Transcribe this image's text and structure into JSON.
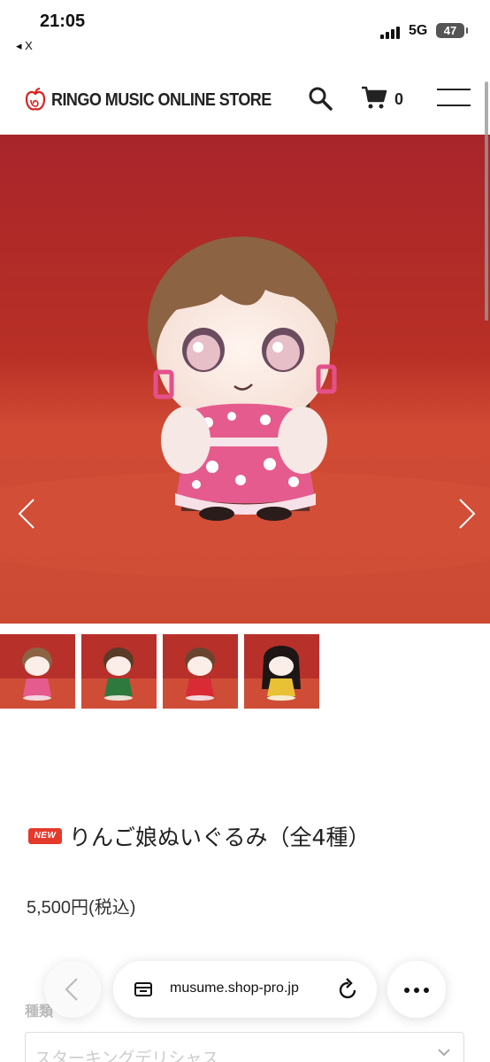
{
  "status_bar": {
    "time": "21:05",
    "back_app": "◂ X",
    "network": "5G",
    "battery": "47"
  },
  "header": {
    "store_name": "RINGO MUSIC ONLINE STORE",
    "cart_count": "0",
    "icons": {
      "logo": "apple-logo-icon",
      "search": "search-icon",
      "cart": "cart-icon",
      "menu": "hamburger-menu-icon"
    }
  },
  "gallery": {
    "prev_icon": "chevron-left-icon",
    "next_icon": "chevron-right-icon",
    "thumbnail_count": 4
  },
  "product": {
    "badge": "NEW",
    "title": "りんご娘ぬいぐるみ（全4種）",
    "price": "5,500円(税込)",
    "variant_label": "種類",
    "variant_value": "スターキングデリシャス"
  },
  "browser": {
    "url": "musume.shop-pro.jp"
  },
  "colors": {
    "badge_red": "#e53a2b",
    "hero_background": "#b8302a",
    "text": "#222222"
  }
}
